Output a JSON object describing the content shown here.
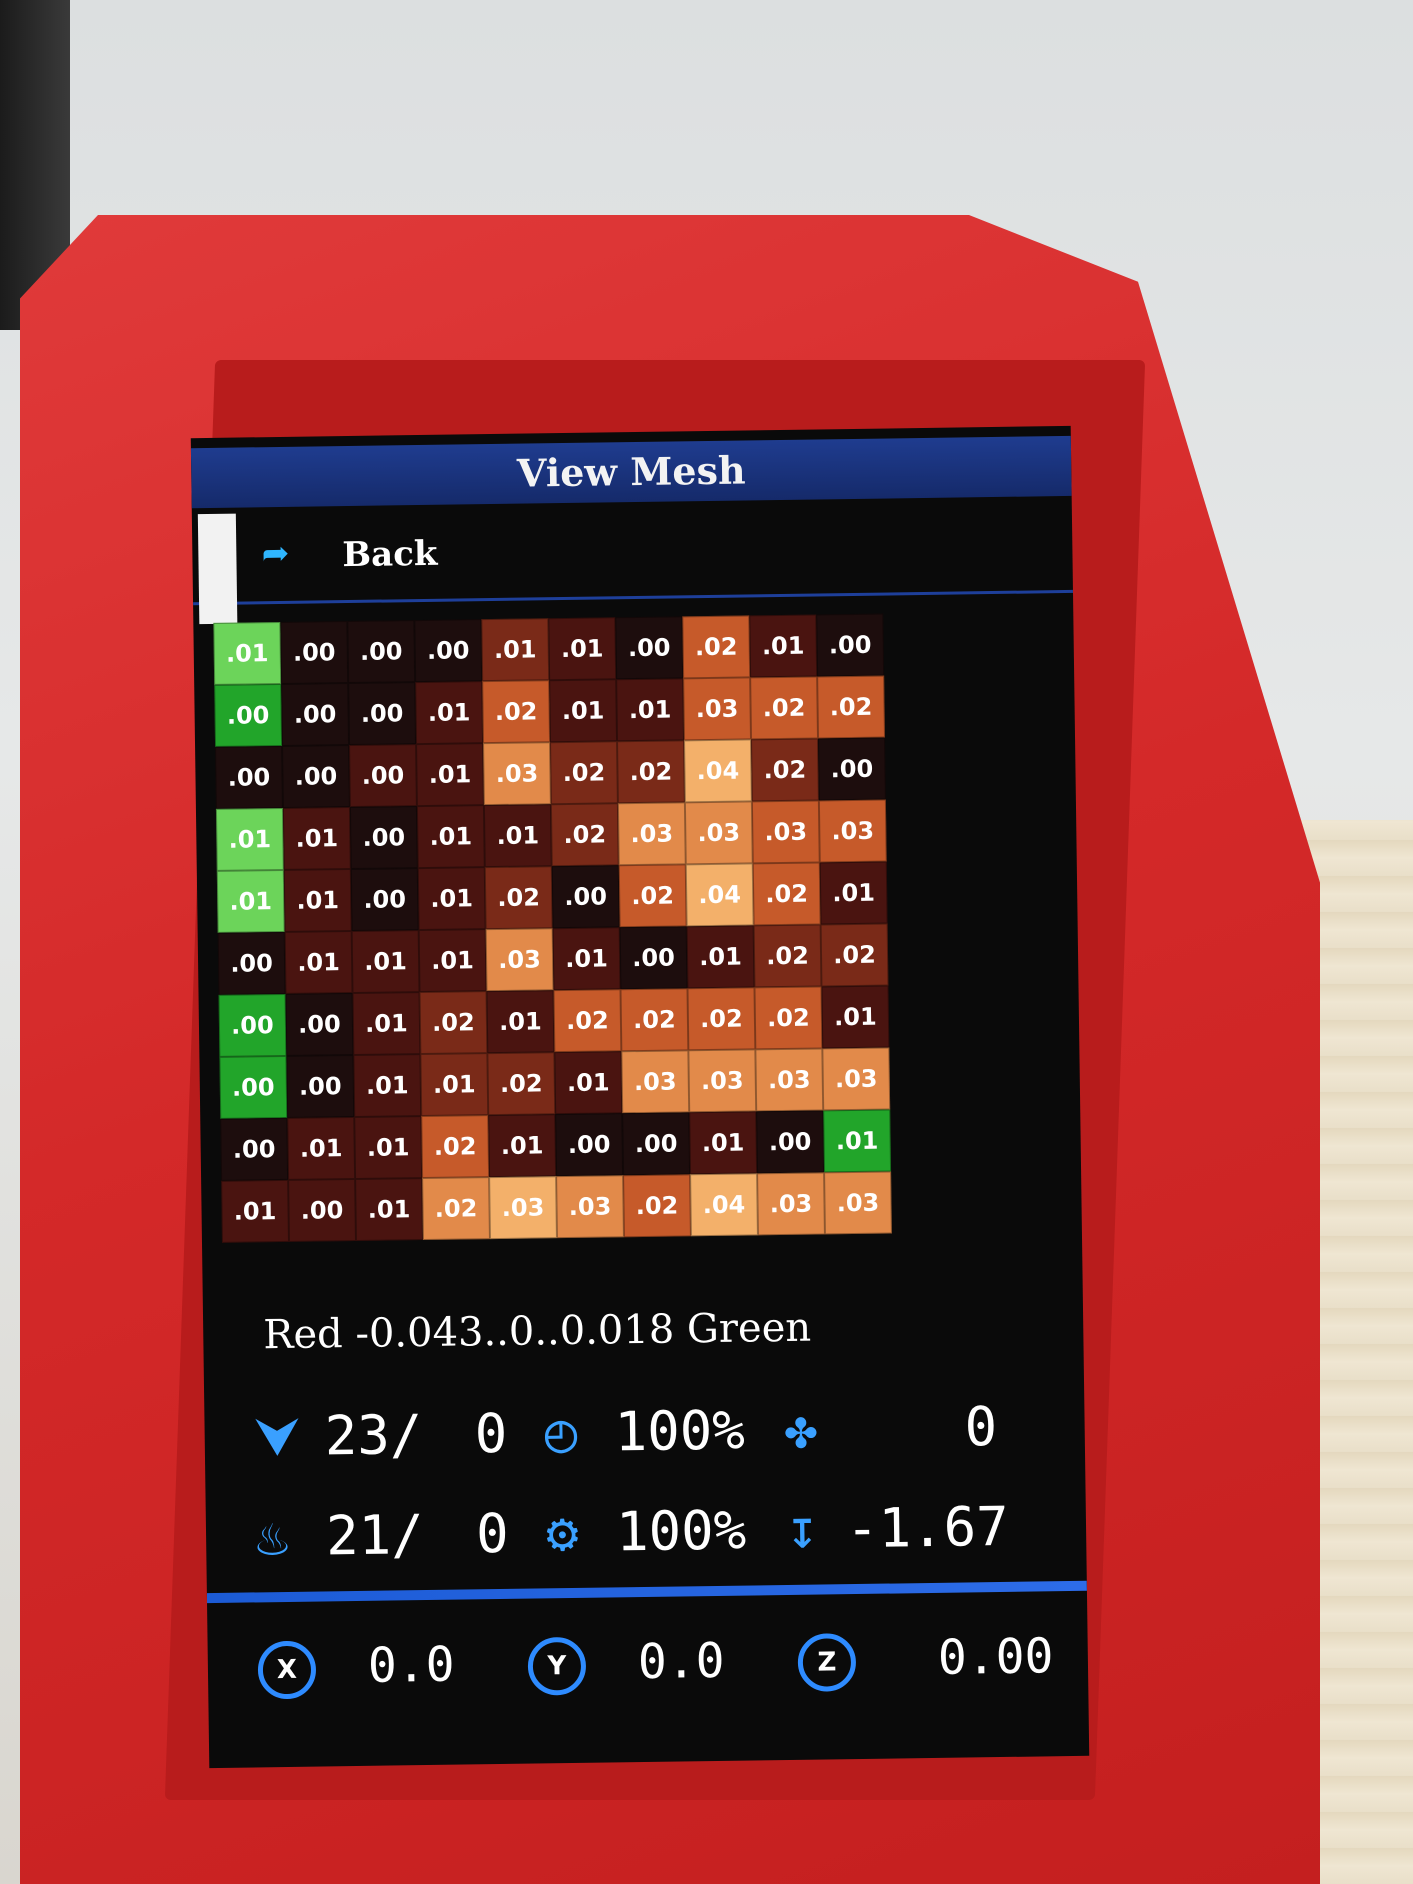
{
  "screen": {
    "title": "View Mesh",
    "back_label": "Back"
  },
  "mesh": {
    "colors": {
      "green_strong": "#22a52a",
      "green_light": "#6cd45a",
      "dark": "#1d0d0d",
      "dark_red": "#4a1410",
      "red_brown": "#7a2a18",
      "orange": "#c65a2a",
      "orange_light": "#e28a4a",
      "peach": "#f3b06a"
    },
    "rows": [
      [
        ".01",
        ".00",
        ".00",
        ".00",
        ".01",
        ".01",
        ".00",
        ".02",
        ".01",
        ".00"
      ],
      [
        ".00",
        ".00",
        ".00",
        ".01",
        ".02",
        ".01",
        ".01",
        ".03",
        ".02",
        ".02"
      ],
      [
        ".00",
        ".00",
        ".00",
        ".01",
        ".03",
        ".02",
        ".02",
        ".04",
        ".02",
        ".00"
      ],
      [
        ".01",
        ".01",
        ".00",
        ".01",
        ".01",
        ".02",
        ".03",
        ".03",
        ".03",
        ".03"
      ],
      [
        ".01",
        ".01",
        ".00",
        ".01",
        ".02",
        ".00",
        ".02",
        ".04",
        ".02",
        ".01"
      ],
      [
        ".00",
        ".01",
        ".01",
        ".01",
        ".03",
        ".01",
        ".00",
        ".01",
        ".02",
        ".02"
      ],
      [
        ".00",
        ".00",
        ".01",
        ".02",
        ".01",
        ".02",
        ".02",
        ".02",
        ".02",
        ".01"
      ],
      [
        ".00",
        ".00",
        ".01",
        ".01",
        ".02",
        ".01",
        ".03",
        ".03",
        ".03",
        ".03"
      ],
      [
        ".00",
        ".01",
        ".01",
        ".02",
        ".01",
        ".00",
        ".00",
        ".01",
        ".00",
        ".01"
      ],
      [
        ".01",
        ".00",
        ".01",
        ".02",
        ".03",
        ".03",
        ".02",
        ".04",
        ".03",
        ".03"
      ]
    ],
    "cell_color_keys": [
      [
        "green_light",
        "dark",
        "dark",
        "dark",
        "red_brown",
        "dark_red",
        "dark",
        "orange",
        "dark_red",
        "dark"
      ],
      [
        "green_strong",
        "dark",
        "dark",
        "dark_red",
        "orange",
        "dark_red",
        "dark_red",
        "orange",
        "orange",
        "orange"
      ],
      [
        "dark",
        "dark",
        "dark_red",
        "dark_red",
        "orange_light",
        "red_brown",
        "red_brown",
        "peach",
        "red_brown",
        "dark"
      ],
      [
        "green_light",
        "dark_red",
        "dark",
        "dark_red",
        "dark_red",
        "red_brown",
        "orange_light",
        "orange_light",
        "orange",
        "orange"
      ],
      [
        "green_light",
        "dark_red",
        "dark",
        "dark_red",
        "red_brown",
        "dark",
        "orange",
        "peach",
        "orange",
        "dark_red"
      ],
      [
        "dark",
        "dark_red",
        "dark_red",
        "dark_red",
        "orange_light",
        "dark_red",
        "dark",
        "dark_red",
        "red_brown",
        "red_brown"
      ],
      [
        "green_strong",
        "dark",
        "dark_red",
        "red_brown",
        "dark_red",
        "orange",
        "orange",
        "orange",
        "orange",
        "dark_red"
      ],
      [
        "green_strong",
        "dark",
        "dark_red",
        "red_brown",
        "red_brown",
        "dark_red",
        "orange_light",
        "orange_light",
        "orange_light",
        "orange_light"
      ],
      [
        "dark",
        "dark_red",
        "dark_red",
        "orange",
        "dark_red",
        "dark",
        "dark",
        "dark_red",
        "dark",
        "green_strong"
      ],
      [
        "dark_red",
        "dark_red",
        "dark_red",
        "orange_light",
        "peach",
        "orange_light",
        "orange",
        "peach",
        "orange_light",
        "orange_light"
      ]
    ],
    "legend": "Red -0.043..0..0.018 Green"
  },
  "status": {
    "hotend_icon": "hotend-nozzle-icon",
    "hotend_current": "23/",
    "hotend_target": "0",
    "speed_icon": "speed-gauge-icon",
    "speed_percent": "100%",
    "fan_icon": "fan-icon",
    "fan_value": "0",
    "bed_icon": "heated-bed-icon",
    "bed_current": "21/",
    "bed_target": "0",
    "flow_icon": "extruder-flow-icon",
    "flow_percent": "100%",
    "zoffset_icon": "z-offset-icon",
    "zoffset_value": "-1.67"
  },
  "axes": {
    "x_label": "X",
    "x_value": "0.0",
    "y_label": "Y",
    "y_value": "0.0",
    "z_label": "Z",
    "z_value": "0.00"
  }
}
